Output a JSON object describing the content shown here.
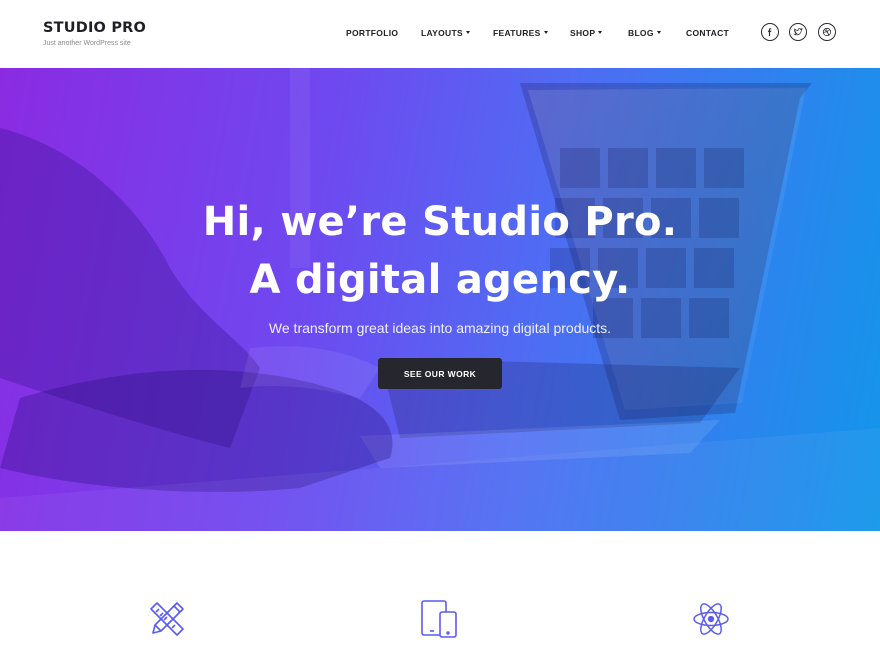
{
  "header": {
    "site_title": "STUDIO PRO",
    "tagline": "Just another WordPress site"
  },
  "nav": {
    "items": [
      {
        "label": "PORTFOLIO",
        "has_dropdown": false
      },
      {
        "label": "LAYOUTS",
        "has_dropdown": true
      },
      {
        "label": "FEATURES",
        "has_dropdown": true
      },
      {
        "label": "SHOP",
        "has_dropdown": true
      },
      {
        "label": "BLOG",
        "has_dropdown": true
      },
      {
        "label": "CONTACT",
        "has_dropdown": false
      }
    ],
    "social": [
      "facebook-icon",
      "twitter-icon",
      "dribbble-icon"
    ]
  },
  "hero": {
    "title_line1": "Hi, we’re Studio Pro.",
    "title_line2": "A digital agency.",
    "subtitle": "We transform great ideas into amazing digital products.",
    "cta_label": "SEE OUR WORK"
  },
  "features": {
    "icons": [
      "pencil-ruler-icon",
      "devices-icon",
      "atom-icon"
    ]
  },
  "colors": {
    "gradient_start": "#8a2be2",
    "gradient_end": "#1296ea",
    "button_bg": "#26262e",
    "icon_accent": "#5a5cf0"
  }
}
